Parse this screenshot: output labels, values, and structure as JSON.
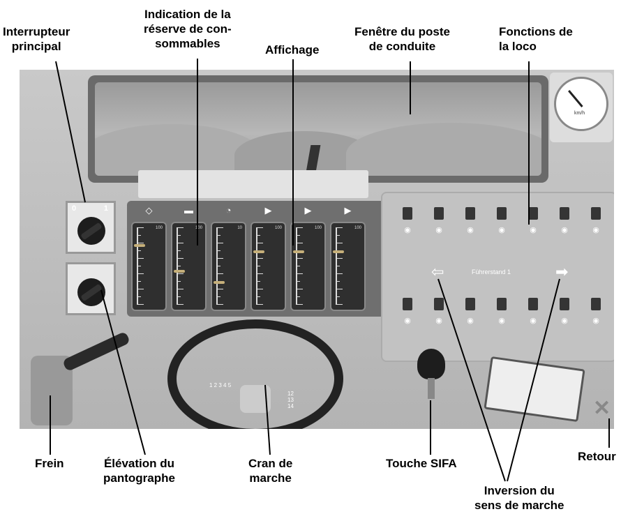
{
  "callouts": {
    "interrupteur": "Interrupteur\nprincipal",
    "indication": "Indication de la\nréserve de con-\nsommables",
    "affichage": "Affichage",
    "fenetre": "Fenêtre du poste\nde conduite",
    "fonctions": "Fonctions de\nla loco",
    "frein": "Frein",
    "elevation": "Élévation du\npantographe",
    "cran": "Cran de\nmarche",
    "sifa": "Touche SIFA",
    "retour": "Retour",
    "inversion": "Inversion du\nsens de marche"
  },
  "panel": {
    "cab_label": "Führerstand 1"
  },
  "main_switch": {
    "off": "0",
    "on": "1"
  },
  "gauges": [
    {
      "icon": "pantograph-icon",
      "max": "100",
      "level": 0.78
    },
    {
      "icon": "sand-icon",
      "max": "100",
      "level": 0.45
    },
    {
      "icon": "speed-limit-icon",
      "max": "10",
      "level": 0.3
    },
    {
      "icon": "oil-can-icon",
      "max": "100",
      "level": 0.7
    },
    {
      "icon": "oil-can-icon",
      "max": "100",
      "level": 0.7
    },
    {
      "icon": "oil-can-icon",
      "max": "100",
      "level": 0.7
    }
  ],
  "speedo": {
    "unit": "km/h",
    "value": 20
  },
  "throttle": {
    "left": "1 2 3 4 5",
    "right": "12 13 14"
  }
}
